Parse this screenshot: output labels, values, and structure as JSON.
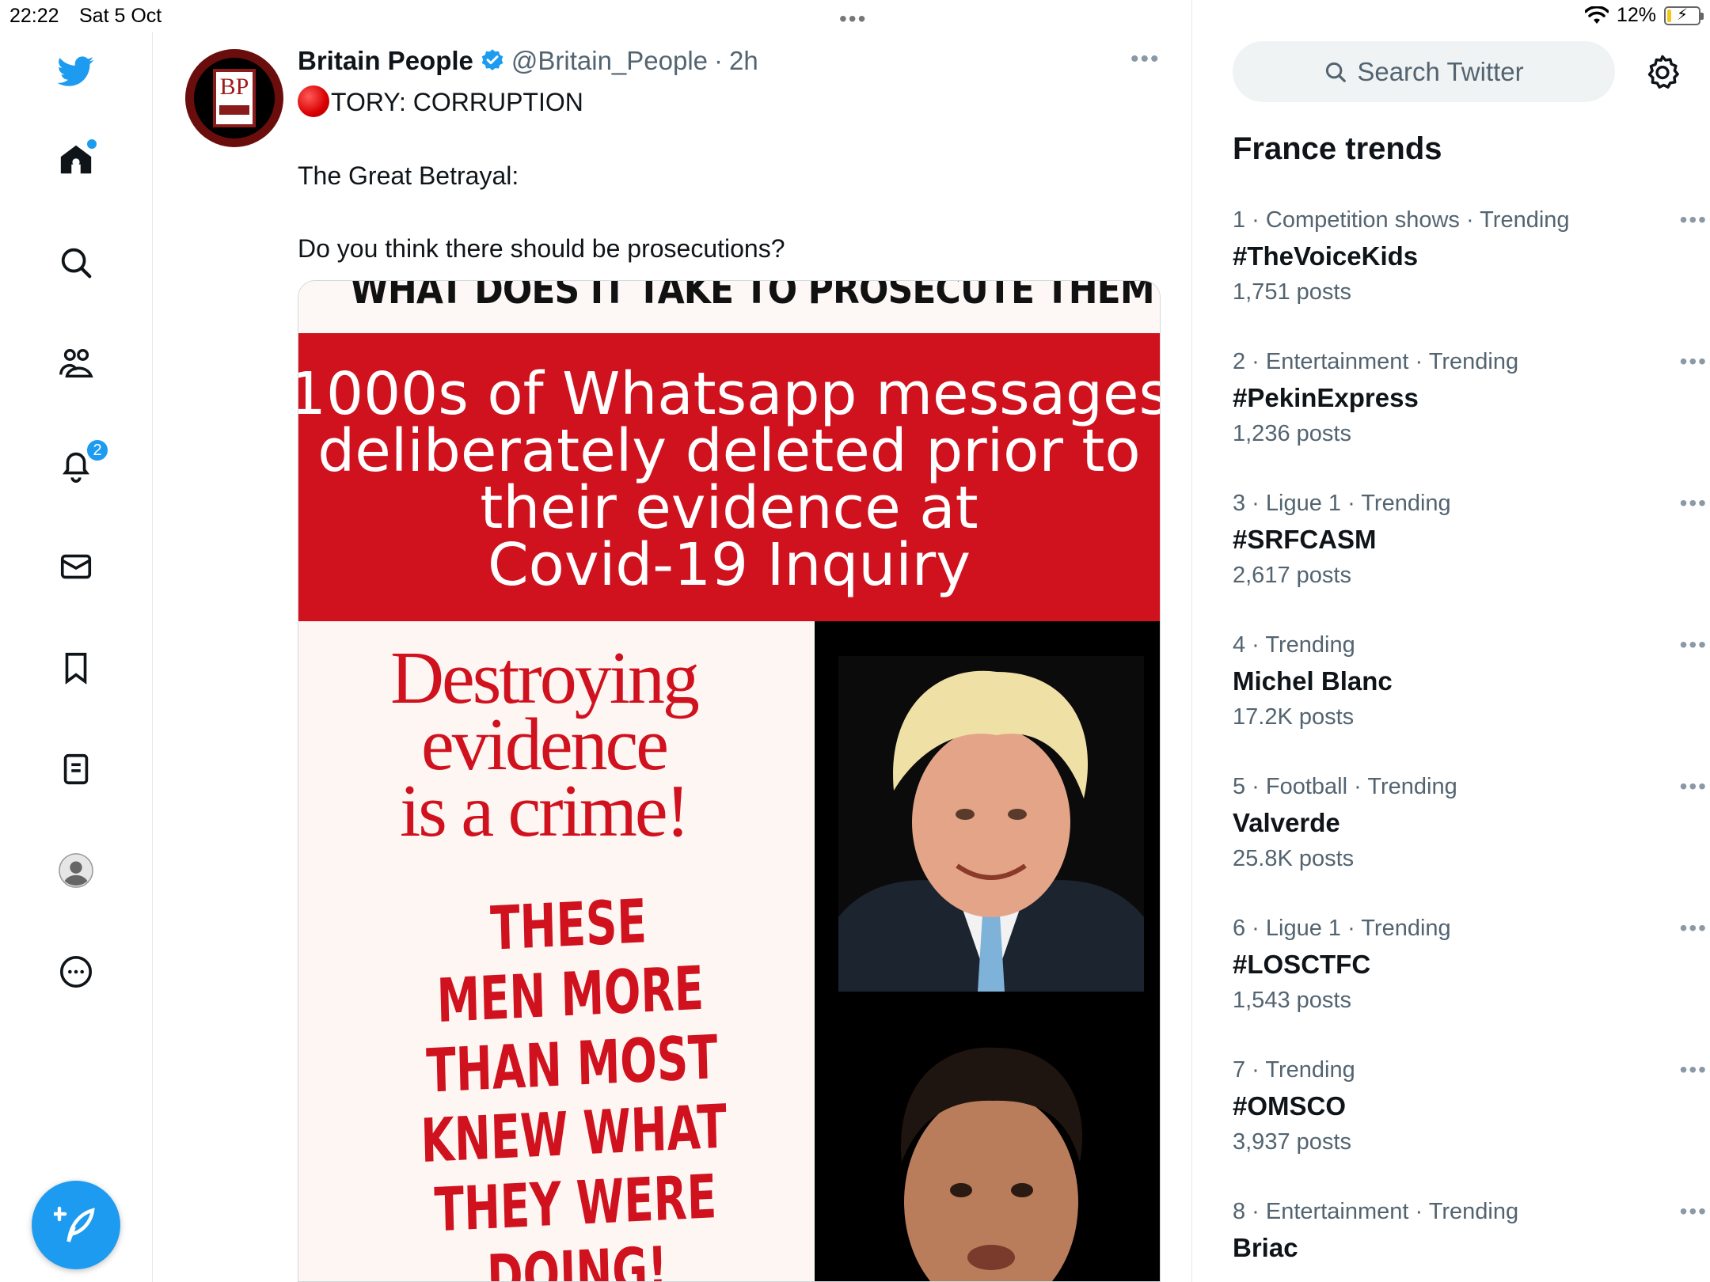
{
  "status_bar": {
    "time": "22:22",
    "date": "Sat 5 Oct",
    "battery_percent": "12%",
    "battery_level": 0.12
  },
  "nav": {
    "notifications_count": "2",
    "accent_color": "#1d9bf0"
  },
  "tweet": {
    "author_name": "Britain People",
    "author_handle": "@Britain_People",
    "separator": "·",
    "time": "2h",
    "line1": "TORY: CORRUPTION",
    "line2": "The Great Betrayal:",
    "line3": "Do you think there should be prosecutions?",
    "media": {
      "cut_headline": "WHAT DOES IT TAKE TO PROSECUTE THEM?",
      "banner_lines": [
        "1000s of Whatsapp messages",
        "deliberately deleted prior to",
        "their evidence at",
        "Covid-19 Inquiry"
      ],
      "crime_lines": [
        "Destroying",
        "evidence",
        "is a crime!"
      ],
      "shout_lines": [
        "THESE",
        "MEN MORE",
        "THAN MOST",
        "KNEW WHAT",
        "THEY WERE DOING!"
      ]
    }
  },
  "sidebar": {
    "search_placeholder": "Search Twitter",
    "trends_title": "France trends",
    "trends": [
      {
        "meta": "1 · Competition shows · Trending",
        "name": "#TheVoiceKids",
        "count": "1,751 posts"
      },
      {
        "meta": "2 · Entertainment · Trending",
        "name": "#PekinExpress",
        "count": "1,236 posts"
      },
      {
        "meta": "3 · Ligue 1 · Trending",
        "name": "#SRFCASM",
        "count": "2,617 posts"
      },
      {
        "meta": "4 · Trending",
        "name": "Michel Blanc",
        "count": "17.2K posts"
      },
      {
        "meta": "5 · Football · Trending",
        "name": "Valverde",
        "count": "25.8K posts"
      },
      {
        "meta": "6 · Ligue 1 · Trending",
        "name": "#LOSCTFC",
        "count": "1,543 posts"
      },
      {
        "meta": "7 · Trending",
        "name": "#OMSCO",
        "count": "3,937 posts"
      },
      {
        "meta": "8 · Entertainment · Trending",
        "name": "Briac",
        "count": ""
      }
    ]
  }
}
